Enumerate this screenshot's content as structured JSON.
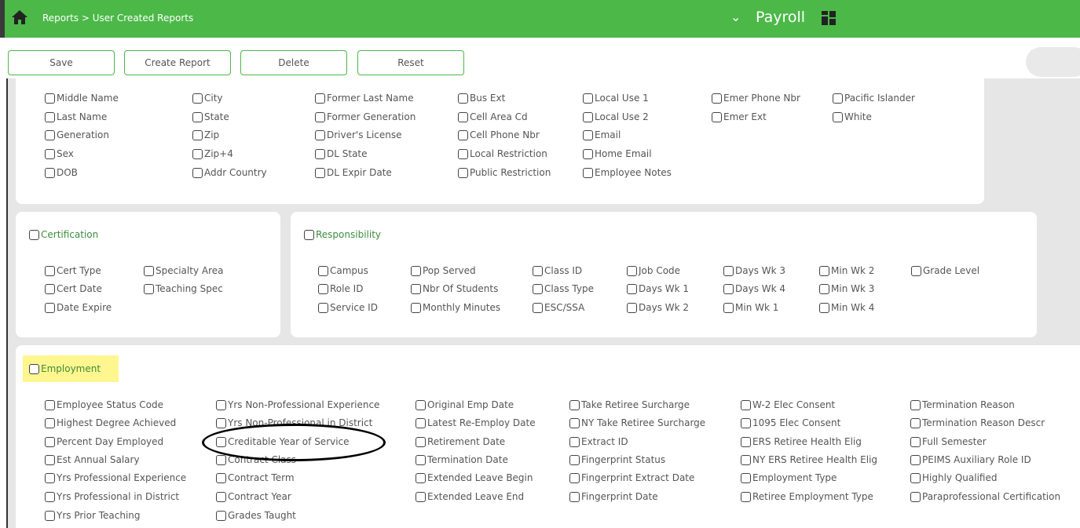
{
  "header": {
    "breadcrumb": "Reports > User Created Reports",
    "app_title": "Payroll",
    "icons": [
      "home-icon",
      "chevron-down-icon",
      "grid-icon"
    ]
  },
  "toolbar": {
    "save_label": "Save",
    "create_report_label": "Create Report",
    "delete_label": "Delete",
    "reset_label": "Reset"
  },
  "demographic": {
    "fields": {
      "middle_name": "Middle Name",
      "last_name": "Last Name",
      "generation": "Generation",
      "sex": "Sex",
      "dob": "DOB",
      "city": "City",
      "state": "State",
      "zip": "Zip",
      "zip4": "Zip+4",
      "addr_country": "Addr Country",
      "former_last_name": "Former Last Name",
      "former_generation": "Former Generation",
      "drivers_license": "Driver's License",
      "dl_state": "DL State",
      "dl_expir_date": "DL Expir Date",
      "bus_ext": "Bus Ext",
      "cell_area_cd": "Cell Area Cd",
      "cell_phone_nbr": "Cell Phone Nbr",
      "local_restriction": "Local Restriction",
      "public_restriction": "Public Restriction",
      "local_use_1": "Local Use 1",
      "local_use_2": "Local Use 2",
      "email": "Email",
      "home_email": "Home Email",
      "employee_notes": "Employee Notes",
      "emer_phone_nbr": "Emer Phone Nbr",
      "emer_ext": "Emer Ext",
      "pacific_islander": "Pacific Islander",
      "white": "White"
    }
  },
  "certification": {
    "title": "Certification",
    "fields": {
      "cert_type": "Cert Type",
      "cert_date": "Cert Date",
      "date_expire": "Date Expire",
      "specialty_area": "Specialty Area",
      "teaching_spec": "Teaching Spec"
    }
  },
  "responsibility": {
    "title": "Responsibility",
    "fields": {
      "campus": "Campus",
      "role_id": "Role ID",
      "service_id": "Service ID",
      "pop_served": "Pop Served",
      "nbr_of_students": "Nbr Of Students",
      "monthly_minutes": "Monthly Minutes",
      "class_id": "Class ID",
      "class_type": "Class Type",
      "esc_ssa": "ESC/SSA",
      "job_code": "Job Code",
      "days_wk_1": "Days Wk 1",
      "days_wk_2": "Days Wk 2",
      "days_wk_3": "Days Wk 3",
      "days_wk_4": "Days Wk 4",
      "min_wk_1": "Min Wk 1",
      "min_wk_2": "Min Wk 2",
      "min_wk_3": "Min Wk 3",
      "min_wk_4": "Min Wk 4",
      "grade_level": "Grade Level"
    }
  },
  "employment": {
    "title": "Employment",
    "fields": {
      "employee_status_code": "Employee Status Code",
      "highest_degree_achieved": "Highest Degree Achieved",
      "percent_day_employed": "Percent Day Employed",
      "est_annual_salary": "Est Annual Salary",
      "yrs_professional_experience": "Yrs Professional Experience",
      "yrs_professional_in_district": "Yrs Professional in District",
      "yrs_prior_teaching": "Yrs Prior Teaching",
      "yrs_non_prof_experience": "Yrs Non-Professional Experience",
      "yrs_non_prof_in_district": "Yrs Non-Professional in District",
      "creditable_year_of_service": "Creditable Year of Service",
      "contract_class": "Contract Class",
      "contract_term": "Contract Term",
      "contract_year": "Contract Year",
      "grades_taught": "Grades Taught",
      "original_emp_date": "Original Emp Date",
      "latest_re_employ_date": "Latest Re-Employ Date",
      "retirement_date": "Retirement Date",
      "termination_date": "Termination Date",
      "extended_leave_begin": "Extended Leave Begin",
      "extended_leave_end": "Extended Leave End",
      "take_retiree_surcharge": "Take Retiree Surcharge",
      "ny_take_retiree_surcharge": "NY Take Retiree Surcharge",
      "extract_id": "Extract ID",
      "fingerprint_status": "Fingerprint Status",
      "fingerprint_extract_date": "Fingerprint Extract Date",
      "fingerprint_date": "Fingerprint Date",
      "w2_elec_consent": "W-2 Elec Consent",
      "elec_consent_1095": "1095 Elec Consent",
      "ers_retiree_health_elig": "ERS Retiree Health Elig",
      "ny_ers_retiree_health_elig": "NY ERS Retiree Health Elig",
      "employment_type": "Employment Type",
      "retiree_employment_type": "Retiree Employment Type",
      "termination_reason": "Termination Reason",
      "termination_reason_descr": "Termination Reason Descr",
      "full_semester": "Full Semester",
      "peims_auxiliary_role_id": "PEIMS Auxiliary Role ID",
      "highly_qualified": "Highly Qualified",
      "paraprofessional_certification": "Paraprofessional Certification"
    }
  },
  "colors": {
    "header_green": "#4cb848",
    "section_title_green": "#3b8d3c",
    "highlight_yellow": "#fff68f",
    "panel_bg": "#e6e6e6"
  }
}
